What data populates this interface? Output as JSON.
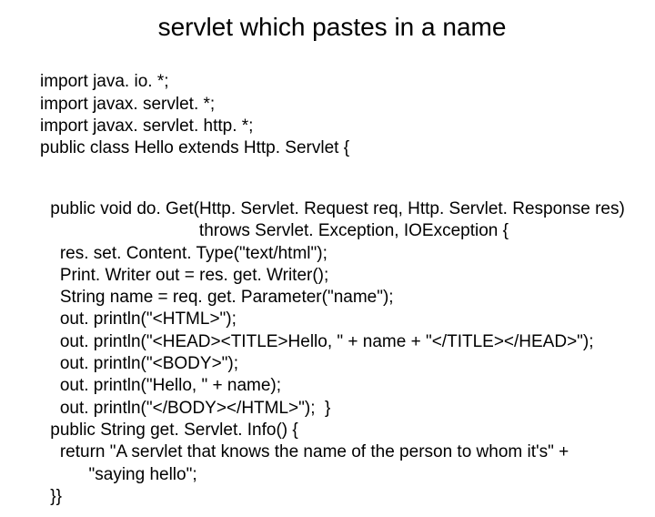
{
  "title": "servlet which pastes in a name",
  "code": {
    "l1": "import java. io. *;",
    "l2": "import javax. servlet. *;",
    "l3": "import javax. servlet. http. *;",
    "l4": "public class Hello extends Http. Servlet {",
    "l5": " public void do. Get(Http. Servlet. Request req, Http. Servlet. Response res)",
    "l6": "                                throws Servlet. Exception, IOException {",
    "l7": "   res. set. Content. Type(\"text/html\");",
    "l8": "   Print. Writer out = res. get. Writer();",
    "l9": "   String name = req. get. Parameter(\"name\");",
    "l10": "   out. println(\"<HTML>\");",
    "l11": "   out. println(\"<HEAD><TITLE>Hello, \" + name + \"</TITLE></HEAD>\");",
    "l12": "   out. println(\"<BODY>\");",
    "l13": "   out. println(\"Hello, \" + name);",
    "l14": "   out. println(\"</BODY></HTML>\");  }",
    "l15": " public String get. Servlet. Info() {",
    "l16": "   return \"A servlet that knows the name of the person to whom it's\" +",
    "l17": "         \"saying hello\";",
    "l18": " }}"
  }
}
